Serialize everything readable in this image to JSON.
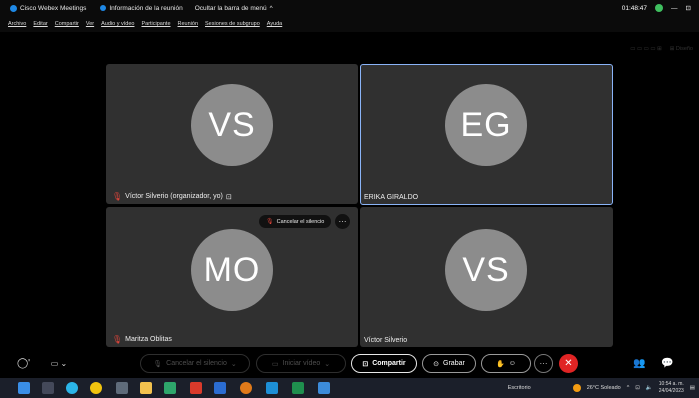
{
  "titlebar": {
    "app": "Cisco Webex Meetings",
    "meeting_info": "Información de la reunión",
    "hide_menu": "Ocultar la barra de menú",
    "hide_menu_caret": "^",
    "timer": "01:48:47",
    "minimize": "—",
    "restore": "⊡"
  },
  "menu": [
    "Archivo",
    "Editar",
    "Compartir",
    "Ver",
    "Audio y vídeo",
    "Participante",
    "Reunión",
    "Sesiones de subgrupo",
    "Ayuda"
  ],
  "faded": {
    "layout": "▭ ▭ ▭ ▭  ⊞",
    "view": "⊞  Diseño"
  },
  "tiles": [
    {
      "initials": "VS",
      "name": "Víctor Silverio (organizador, yo)",
      "muted": true,
      "extra_icon": "⊡"
    },
    {
      "initials": "EG",
      "name": "ERIKA GIRALDO",
      "muted": false,
      "active": true
    },
    {
      "initials": "MO",
      "name": "Maritza Oblitas",
      "muted": true,
      "pill": "Cancelar el silencio",
      "more": "···"
    },
    {
      "initials": "VS",
      "name": "Víctor Silverio",
      "muted": false
    }
  ],
  "controls": {
    "unmute": "Cancelar el silencio",
    "start_video": "Iniciar vídeo",
    "share": "Compartir",
    "record": "Grabar",
    "more": "···",
    "end": "✕",
    "left1": "◯'",
    "left2": "▭ ⌄"
  },
  "taskbar": {
    "desktop": "Escritorio",
    "weather": "26°C Soleado",
    "time": "10:54 a. m.",
    "date": "24/04/2023"
  },
  "colors": {
    "accent": "#8ab4f8",
    "end_call": "#e02424",
    "tile_bg": "#303030",
    "avatar": "#8c8c8c"
  }
}
